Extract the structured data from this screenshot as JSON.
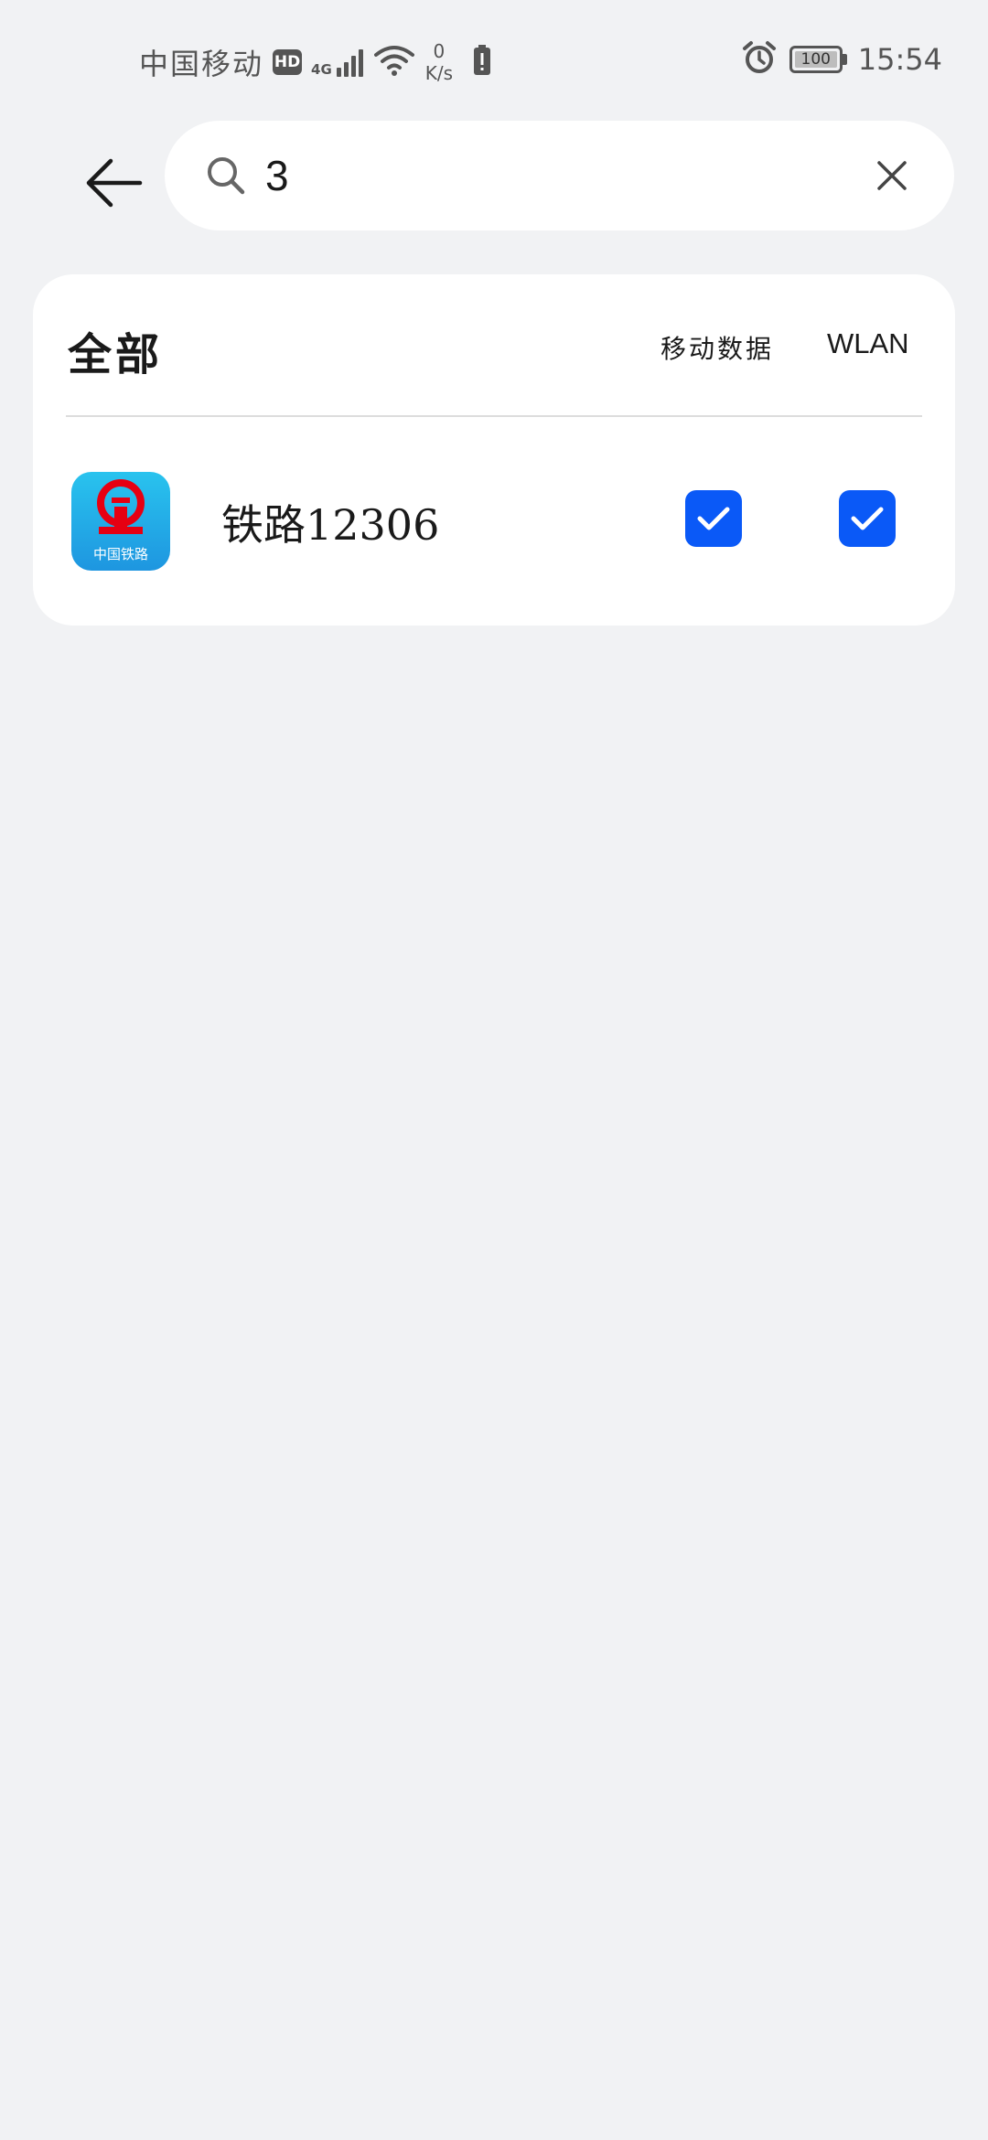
{
  "status_bar": {
    "carrier": "中国移动",
    "hd": "HD",
    "network": "4G",
    "speed_value": "0",
    "speed_unit": "K/s",
    "battery": "100",
    "time": "15:54"
  },
  "search": {
    "query": "3"
  },
  "filter": {
    "all_label": "全部",
    "col_mobile": "移动数据",
    "col_wlan": "WLAN"
  },
  "apps": [
    {
      "name": "铁路12306",
      "icon_caption": "中国铁路",
      "mobile_data": true,
      "wlan": true
    }
  ],
  "colors": {
    "accent": "#0a59f7",
    "background": "#f1f2f4",
    "card": "#ffffff",
    "rail_logo": "#e60012"
  }
}
